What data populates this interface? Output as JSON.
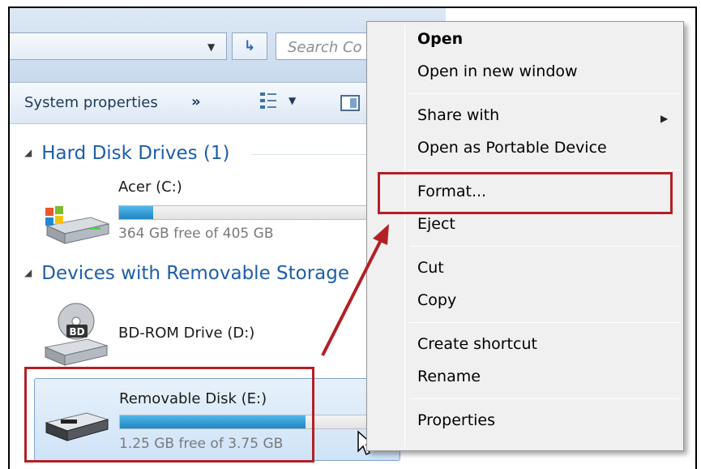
{
  "explorer": {
    "search_placeholder": "Search Co",
    "toolbar": {
      "system_properties": "System properties",
      "more": "»"
    },
    "groups": [
      {
        "header": "Hard Disk Drives (1)"
      },
      {
        "header": "Devices with Removable Storage"
      }
    ],
    "drives": [
      {
        "name": "Acer (C:)",
        "free_text": "364 GB free of 405 GB",
        "used_fraction": 0.1
      },
      {
        "name": "BD-ROM Drive (D:)",
        "icon_label": "BD"
      },
      {
        "name": "Removable Disk (E:)",
        "free_text": "1.25 GB free of 3.75 GB",
        "used_fraction": 0.667
      }
    ]
  },
  "context_menu": {
    "items": [
      {
        "label": "Open",
        "bold": true
      },
      {
        "label": "Open in new window"
      },
      {
        "label": "Share with",
        "has_submenu": true
      },
      {
        "label": "Open as Portable Device"
      },
      {
        "label": "Format..."
      },
      {
        "label": "Eject"
      },
      {
        "label": "Cut"
      },
      {
        "label": "Copy"
      },
      {
        "label": "Create shortcut"
      },
      {
        "label": "Rename"
      },
      {
        "label": "Properties"
      }
    ]
  },
  "colors": {
    "annotation": "#b22025",
    "group_header": "#1e5ea8",
    "progress": "#1f86c4"
  },
  "icons": [
    "dropdown-arrow-icon",
    "refresh-icon",
    "view-options-icon",
    "preview-pane-icon",
    "windows-drive-icon",
    "bd-rom-drive-icon",
    "removable-disk-icon",
    "submenu-arrow-icon",
    "mouse-cursor-icon",
    "annotation-arrow-icon"
  ]
}
